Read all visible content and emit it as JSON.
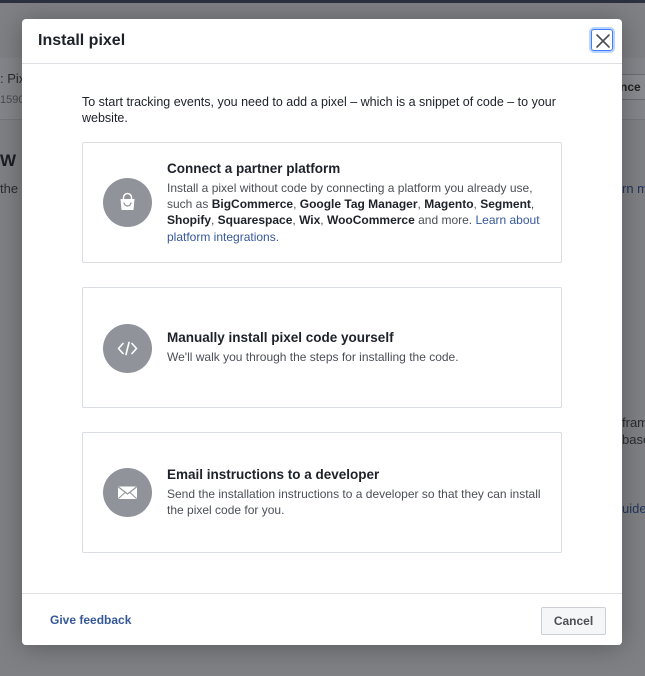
{
  "background": {
    "fragments": {
      "f1": ": Pix",
      "f2": "1590",
      "f3": "W",
      "f4": "the",
      "f5": "rn m",
      "f6": "fram",
      "f7": "base",
      "f8": "uide",
      "btn": "nce"
    }
  },
  "modal": {
    "title": "Install pixel",
    "close_label": "Close",
    "intro": "To start tracking events, you need to add a pixel – which is a snippet of code – to your website.",
    "options": [
      {
        "title": "Connect a partner platform",
        "desc_prefix": "Install a pixel without code by connecting a platform you already use, such as ",
        "platforms": [
          "BigCommerce",
          "Google Tag Manager",
          "Magento",
          "Segment",
          "Shopify",
          "Squarespace",
          "Wix",
          "WooCommerce"
        ],
        "sep": ", ",
        "desc_suffix": " and more.",
        "link": "Learn about platform integrations.",
        "icon": "shopping-bag-icon"
      },
      {
        "title": "Manually install pixel code yourself",
        "desc": "We'll walk you through the steps for installing the code.",
        "icon": "code-icon"
      },
      {
        "title": "Email instructions to a developer",
        "desc": "Send the installation instructions to a developer so that they can install the pixel code for you.",
        "icon": "envelope-icon"
      }
    ],
    "footer": {
      "feedback": "Give feedback",
      "cancel": "Cancel"
    }
  },
  "colors": {
    "link": "#365899",
    "icon_bg": "#909399",
    "focus_ring": "#4080ff"
  }
}
